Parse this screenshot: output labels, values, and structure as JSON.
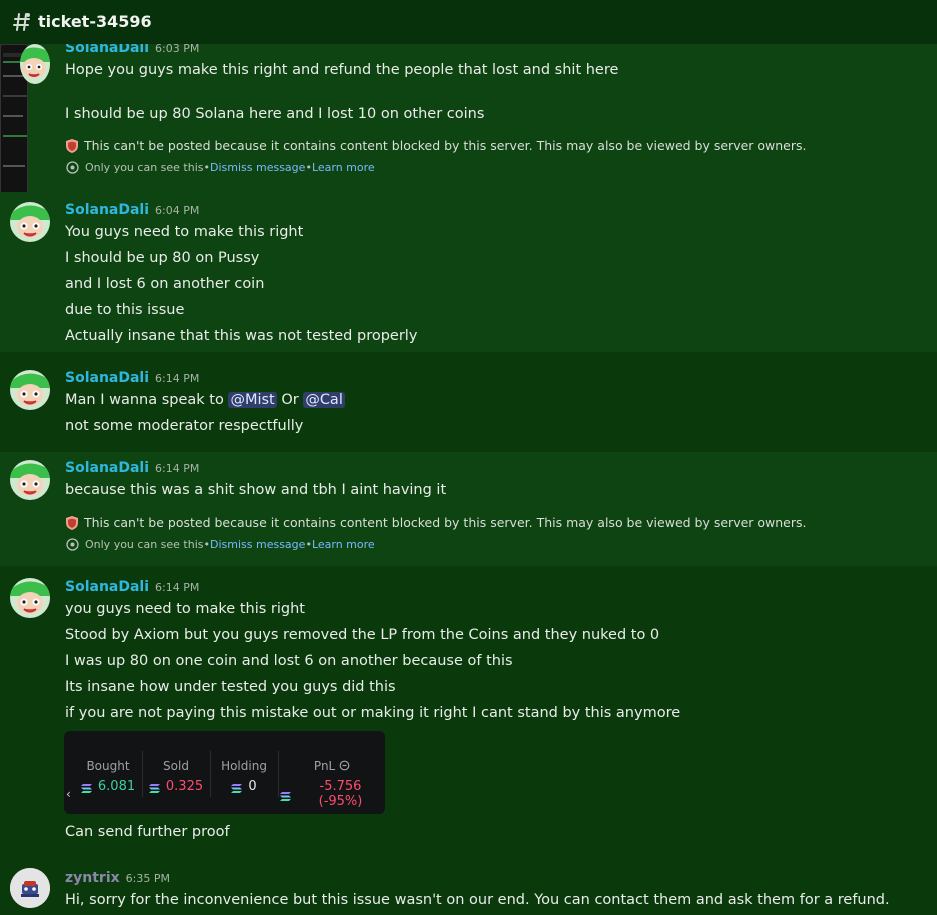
{
  "channel": {
    "name": "ticket-34596",
    "icon": "hashtag-icon"
  },
  "messages": [
    {
      "author": "SolanaDali",
      "time": "6:03 PM",
      "lines": [
        "Hope you guys make this right and refund the people that lost and shit here",
        "I should be up 80 Solana here and I lost 10 on other coins"
      ],
      "blocked": "This can't be posted because it contains content blocked by this server. This may also be viewed by server owners.",
      "ephemeral": {
        "text": "Only you can see this",
        "dismiss": "Dismiss message",
        "learn": "Learn more"
      }
    },
    {
      "author": "SolanaDali",
      "time": "6:04 PM",
      "lines": [
        "You guys need to make this right",
        "I should be up 80 on Pussy",
        "and I lost 6 on another coin",
        "due to this issue",
        "Actually insane that this was not tested properly"
      ]
    },
    {
      "author": "SolanaDali",
      "time": "6:14 PM",
      "line1_prefix": "Man I wanna speak to ",
      "mention1": "@Mist",
      "line1_mid": " Or ",
      "mention2": "@Cal",
      "line2": "not some moderator respectfully"
    },
    {
      "author": "SolanaDali",
      "time": "6:14 PM",
      "lines": [
        "because this was a shit show and tbh I aint having it"
      ],
      "blocked": "This can't be posted because it contains content blocked by this server. This may also be viewed by server owners.",
      "ephemeral": {
        "text": "Only you can see this",
        "dismiss": "Dismiss message",
        "learn": "Learn more"
      }
    },
    {
      "author": "SolanaDali",
      "time": "6:14 PM",
      "lines": [
        "you guys need to make this right",
        "Stood by Axiom but you guys removed the LP from the Coins and they nuked to 0",
        "I was up 80 on one coin and lost 6 on another because of this",
        "Its insane how under tested you guys did this",
        "if you are not paying this mistake out or making it right I cant stand by this anymore"
      ],
      "embed": {
        "bought_label": "Bought",
        "bought": "6.081",
        "sold_label": "Sold",
        "sold": "0.325",
        "holding_label": "Holding",
        "holding": "0",
        "pnl_label": "PnL",
        "pnl": "-5.756 (-95%)",
        "arrow": "‹"
      },
      "after": "Can send further proof"
    },
    {
      "author": "zyntrix",
      "time": "6:35 PM",
      "lines": [
        "Hi, sorry for the inconvenience but this issue wasn't on our end. You can contact them and ask them for a refund."
      ]
    }
  ],
  "separator": " • ",
  "colors": {
    "background": "#0a3a0c",
    "highlight": "#0e4411",
    "username": "#2fb7e0",
    "link": "#7ab8ff",
    "positive": "#3ad29a",
    "negative": "#ff4d6e"
  }
}
